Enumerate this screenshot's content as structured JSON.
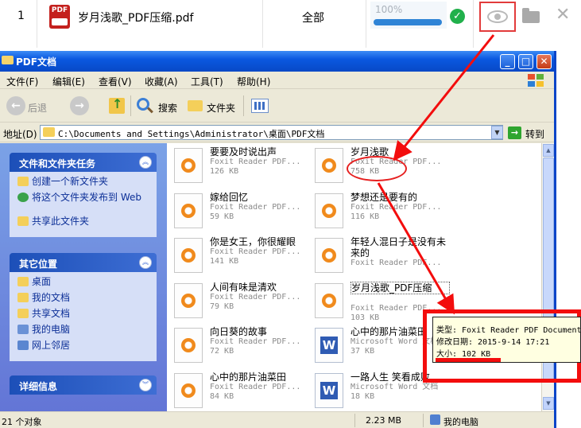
{
  "top_row": {
    "index": "1",
    "file_name": "岁月浅歌_PDF压缩.pdf",
    "pdf_badge": "PDF",
    "scope": "全部",
    "progress_text": "100%",
    "progress": 1.0,
    "ok_glyph": "✓",
    "close_glyph": "✕",
    "icons": [
      "pdf-file-icon",
      "check-circle-icon",
      "eye-icon",
      "folder-icon",
      "close-icon"
    ]
  },
  "window": {
    "title": "PDF文档",
    "controls": {
      "minimize": "_",
      "maximize": "□",
      "close": "✕"
    },
    "menu": [
      "文件(F)",
      "编辑(E)",
      "查看(V)",
      "收藏(A)",
      "工具(T)",
      "帮助(H)"
    ],
    "toolbar": {
      "back": "后退",
      "back_glyph": "←",
      "forward_glyph": "→",
      "search": "搜索",
      "folders": "文件夹"
    },
    "address": {
      "label": "地址(D)",
      "path": "C:\\Documents and Settings\\Administrator\\桌面\\PDF文档",
      "go": "转到",
      "dropdown_glyph": "▼",
      "go_glyph": "→"
    }
  },
  "left_pane": {
    "tasks": {
      "header": "文件和文件夹任务",
      "chevron": "︽",
      "items": [
        "创建一个新文件夹",
        "将这个文件夹发布到 Web",
        "共享此文件夹"
      ]
    },
    "places": {
      "header": "其它位置",
      "chevron": "︽",
      "items": [
        "桌面",
        "我的文档",
        "共享文档",
        "我的电脑",
        "网上邻居"
      ]
    },
    "details": {
      "header": "详细信息",
      "chevron": "︾"
    }
  },
  "files": [
    {
      "name": "要要及时说出声",
      "type": "Foxit Reader PDF...",
      "size": "126 KB",
      "kind": "pdf"
    },
    {
      "name": "岁月浅歌",
      "type": "Foxit Reader PDF...",
      "size": "758 KB",
      "kind": "pdf"
    },
    {
      "name": "嫁给回忆",
      "type": "Foxit Reader PDF...",
      "size": "59 KB",
      "kind": "pdf"
    },
    {
      "name": "梦想还是要有的",
      "type": "Foxit Reader PDF...",
      "size": "116 KB",
      "kind": "pdf"
    },
    {
      "name": "你是女王，你很耀眼",
      "type": "Foxit Reader PDF...",
      "size": "141 KB",
      "kind": "pdf"
    },
    {
      "name": "年轻人混日子是没有未来的",
      "type": "Foxit Reader PDF...",
      "size": "",
      "kind": "pdf"
    },
    {
      "name": "人间有味是清欢",
      "type": "Foxit Reader PDF...",
      "size": "79 KB",
      "kind": "pdf"
    },
    {
      "name": "岁月浅歌_PDF压缩",
      "type": "Foxit Reader PDF...",
      "size": "103 KB",
      "kind": "pdf",
      "selected": true
    },
    {
      "name": "向日葵的故事",
      "type": "Foxit Reader PDF...",
      "size": "72 KB",
      "kind": "pdf"
    },
    {
      "name": "心中的那片油菜田",
      "type": "Microsoft Word 文档",
      "size": "37 KB",
      "kind": "doc"
    },
    {
      "name": "心中的那片油菜田",
      "type": "Foxit Reader PDF...",
      "size": "84 KB",
      "kind": "pdf"
    },
    {
      "name": "一路人生 笑看成败",
      "type": "Microsoft Word 文档",
      "size": "18 KB",
      "kind": "doc"
    }
  ],
  "scroll": {
    "up_glyph": "▲",
    "down_glyph": "▼"
  },
  "status": {
    "count": "21 个对象",
    "size": "2.23 MB",
    "location": "我的电脑"
  },
  "tooltip": {
    "type_line": "类型: Foxit Reader PDF Document",
    "modified_line": "修改日期: 2015-9-14 17:21",
    "size_line": "大小: 102 KB"
  },
  "colors": {
    "annotation_red": "#f30d0d",
    "xp_blue": "#0a58e0",
    "progress_blue": "#2f84d6",
    "ok_green": "#21b04b"
  }
}
